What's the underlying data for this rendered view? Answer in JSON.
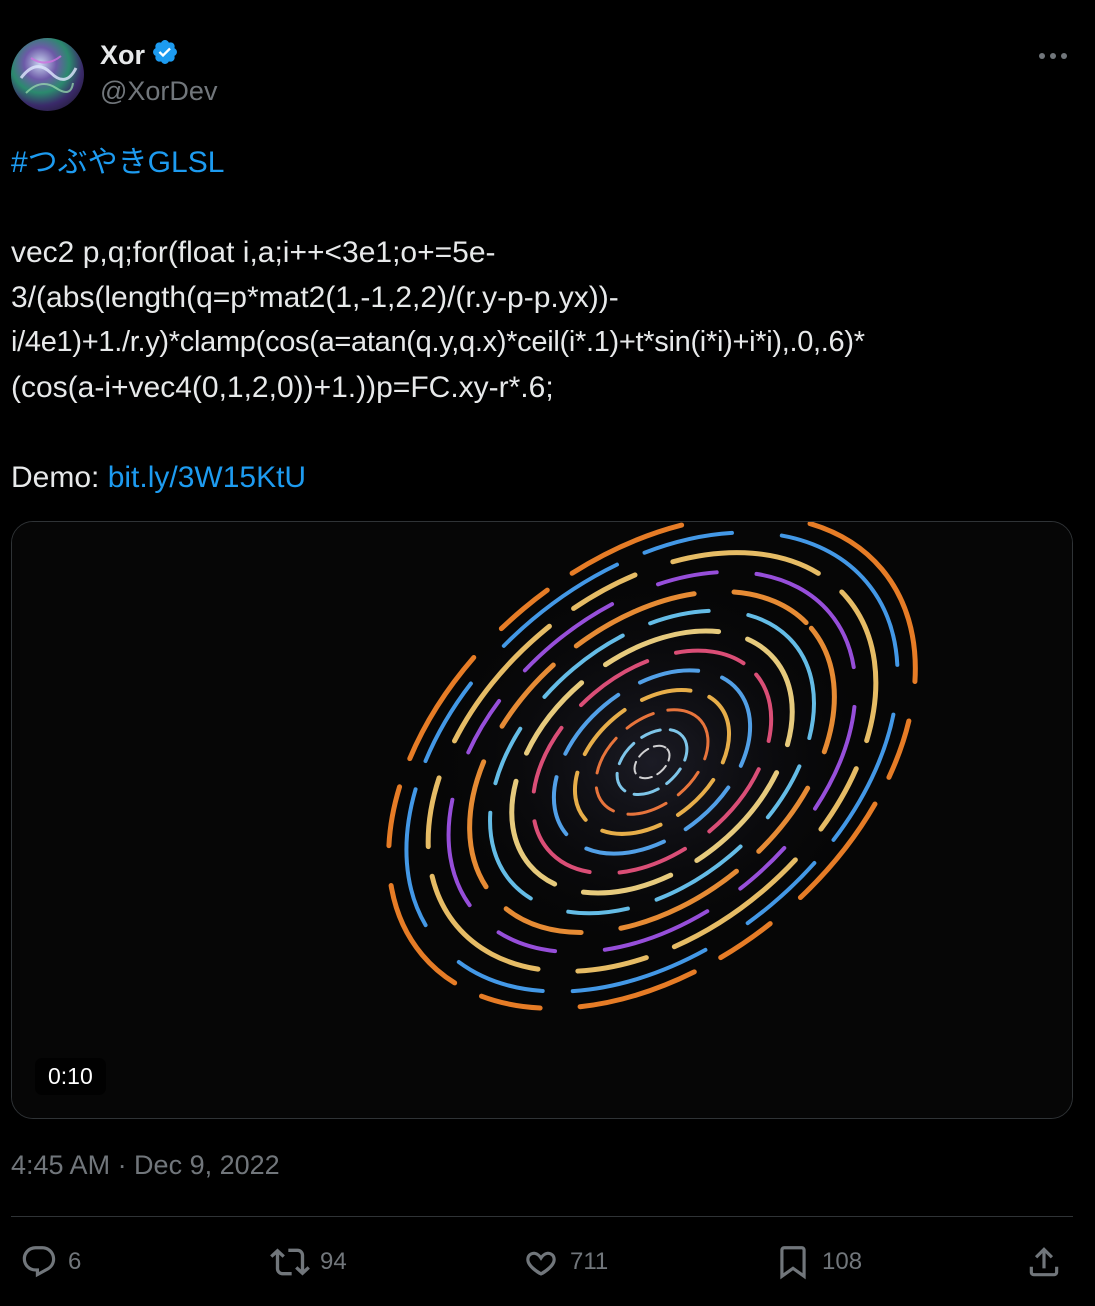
{
  "author": {
    "name": "Xor",
    "handle": "@XorDev",
    "verified_color": "#1d9bf0"
  },
  "tweet": {
    "hashtag": "#つぶやきGLSL",
    "code_lines": [
      "vec2 p,q;for(float i,a;i++<3e1;o+=5e-",
      "3/(abs(length(q=p*mat2(1,-1,2,2)/(r.y-p-p.yx))-",
      "i/4e1)+1./r.y)*clamp(cos(a=atan(q.y,q.x)*ceil(i*.1)+t*sin(i*i)+i*i),.0,.6)*",
      "(cos(a-i+vec4(0,1,2,0))+1.))p=FC.xy-r*.6;"
    ],
    "demo_label": "Demo:",
    "demo_link": "bit.ly/3W15KtU"
  },
  "media": {
    "duration": "0:10"
  },
  "timestamp": "4:45 AM · Dec 9, 2022",
  "actions": {
    "replies": "6",
    "reposts": "94",
    "likes": "711",
    "bookmarks": "108"
  },
  "colors": {
    "text": "#e7e9ea",
    "secondary": "#71767b",
    "link": "#1d9bf0",
    "background": "#000000"
  },
  "icons": [
    "more-icon",
    "verified-icon",
    "reply-icon",
    "repost-icon",
    "like-icon",
    "bookmark-icon",
    "share-icon"
  ]
}
